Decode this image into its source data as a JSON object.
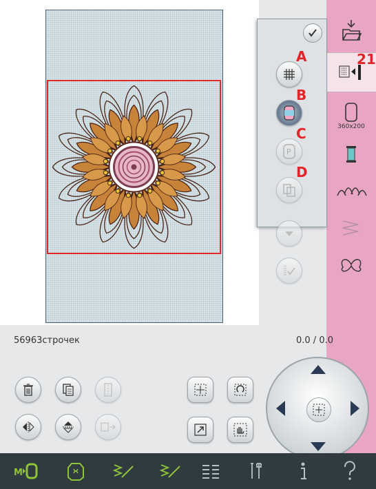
{
  "status": {
    "stitch_count": "56963строчек",
    "position": "0.0 / 0.0"
  },
  "sidebar": {
    "items": [
      {
        "name": "load-design",
        "icon": "folder-load-icon"
      },
      {
        "name": "edit-mode",
        "icon": "stitch-order-icon",
        "selected": true
      },
      {
        "name": "hoop-size",
        "icon": "hoop-icon",
        "label": "360x200"
      },
      {
        "name": "thread-colors",
        "icon": "thread-spool-icon"
      },
      {
        "name": "design-lineup",
        "icon": "design-flowers-icon"
      },
      {
        "name": "stitch-out",
        "icon": "stitch-out-icon",
        "disabled": true
      },
      {
        "name": "stitch-butterfly",
        "icon": "butterfly-icon"
      }
    ],
    "callout": "21"
  },
  "popup": {
    "confirm_icon": "check-icon",
    "buttons": [
      {
        "letter": "A",
        "icon": "grid-icon"
      },
      {
        "letter": "B",
        "icon": "color-block-icon"
      },
      {
        "letter": "C",
        "icon": "park-icon",
        "disabled": true
      },
      {
        "letter": "D",
        "icon": "copy-layers-icon",
        "disabled": true
      }
    ]
  },
  "toolbar": {
    "left": [
      "trash-icon",
      "copy-icon",
      "align-icon",
      "mirror-horizontal-icon",
      "mirror-vertical-icon",
      "duplicate-icon"
    ],
    "middle": [
      "move-icon",
      "rotate-icon",
      "scale-icon",
      "pan-hand-icon"
    ]
  },
  "bottom_bar": [
    "embroidery-mode-icon",
    "design-icon",
    "stitch-edit-icon",
    "stitch-program-icon",
    "menu-icon",
    "tools-icon",
    "info-icon",
    "help-icon"
  ],
  "colors": {
    "sidebar_pink": "#e8a6c4",
    "frame_red": "#e0262b",
    "bottom_bar": "#2f3b3e"
  }
}
